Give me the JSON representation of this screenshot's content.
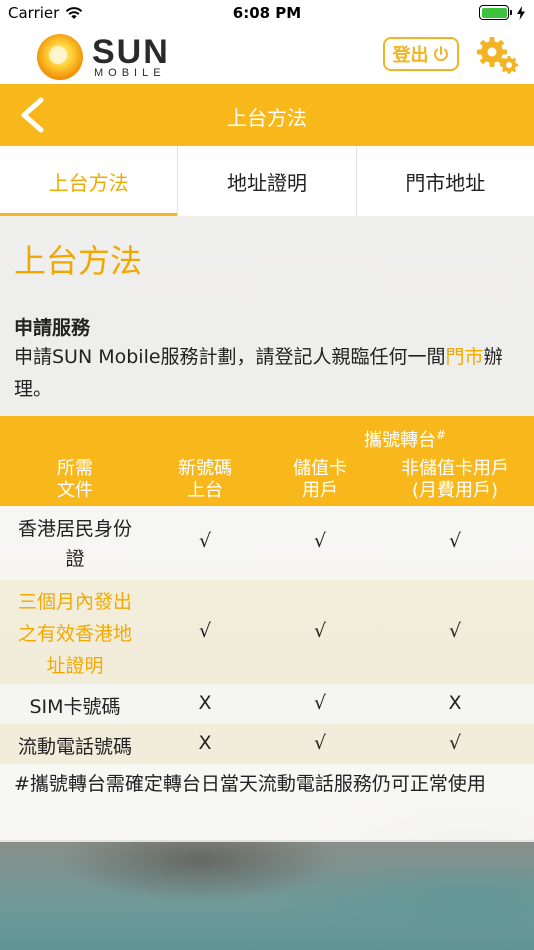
{
  "status_bar": {
    "carrier": "Carrier",
    "time": "6:08 PM"
  },
  "header": {
    "logo_text": "SUN",
    "logo_sub": "MOBILE",
    "logout_label": "登出",
    "brand_color": "#f8b81c"
  },
  "nav": {
    "title": "上台方法"
  },
  "tabs": [
    {
      "label": "上台方法",
      "active": true
    },
    {
      "label": "地址證明",
      "active": false
    },
    {
      "label": "門市地址",
      "active": false
    }
  ],
  "content": {
    "section_title": "上台方法",
    "sub_title": "申請服務",
    "desc_prefix": "申請SUN Mobile服務計劃，請登記人親臨任何一間",
    "desc_link": "門市",
    "desc_suffix": "辦理。"
  },
  "table": {
    "group_header": "攜號轉台",
    "group_mark": "#",
    "headers": [
      {
        "line1": "所需",
        "line2": "文件"
      },
      {
        "line1": "新號碼",
        "line2": "上台"
      },
      {
        "line1": "儲值卡",
        "line2": "用戶"
      },
      {
        "line1": "非儲值卡用戶",
        "line2": "(月費用戶)"
      }
    ],
    "rows": [
      {
        "name_lines": [
          "香港居民身份",
          "證"
        ],
        "values": [
          "√",
          "√",
          "√"
        ]
      },
      {
        "name_lines": [
          "三個月內發出",
          "之有效香港地",
          "址證明"
        ],
        "values": [
          "√",
          "√",
          "√"
        ]
      },
      {
        "name_lines": [
          "SIM卡號碼"
        ],
        "values": [
          "X",
          "√",
          "X"
        ]
      },
      {
        "name_lines": [
          "流動電話號碼"
        ],
        "values": [
          "X",
          "√",
          "√"
        ]
      }
    ],
    "footnote": "#攜號轉台需確定轉台日當天流動電話服務仍可正常使用"
  }
}
